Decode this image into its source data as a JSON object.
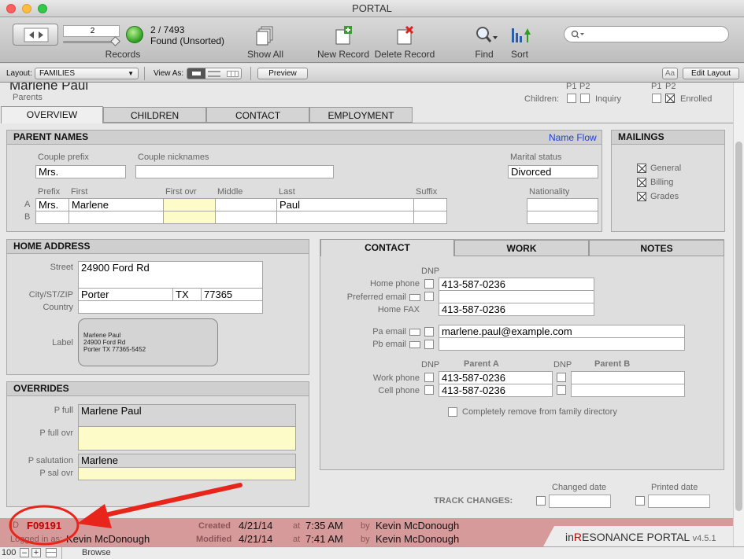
{
  "window": {
    "title": "PORTAL"
  },
  "toolbar": {
    "record_value": "2",
    "record_count": "2 / 7493",
    "found_status": "Found (Unsorted)",
    "records_label": "Records",
    "show_all": "Show All",
    "new_record": "New Record",
    "delete_record": "Delete Record",
    "find": "Find",
    "sort": "Sort",
    "search_value": ""
  },
  "layoutbar": {
    "layout_label": "Layout:",
    "layout_value": "FAMILIES",
    "view_as_label": "View As:",
    "preview": "Preview",
    "aa": "Aa",
    "edit_layout": "Edit Layout"
  },
  "header": {
    "name": "Marlene Paul",
    "subtitle": "Parents",
    "children_label": "Children:",
    "p1": "P1",
    "p2": "P2",
    "inquiry": "Inquiry",
    "enrolled": "Enrolled"
  },
  "tabs": [
    "OVERVIEW",
    "CHILDREN",
    "CONTACT",
    "EMPLOYMENT"
  ],
  "parent_names": {
    "title": "PARENT NAMES",
    "name_flow": "Name Flow",
    "couple_prefix_label": "Couple prefix",
    "couple_prefix": "Mrs.",
    "couple_nicknames_label": "Couple nicknames",
    "couple_nicknames": "",
    "marital_status_label": "Marital status",
    "marital_status": "Divorced",
    "prefix_label": "Prefix",
    "first_label": "First",
    "first_ovr_label": "First ovr",
    "middle_label": "Middle",
    "last_label": "Last",
    "suffix_label": "Suffix",
    "nationality_label": "Nationality",
    "row_a": "A",
    "row_b": "B",
    "a_prefix": "Mrs.",
    "a_first": "Marlene",
    "a_last": "Paul"
  },
  "mailings": {
    "title": "MAILINGS",
    "general": "General",
    "billing": "Billing",
    "grades": "Grades"
  },
  "home_address": {
    "title": "HOME ADDRESS",
    "street_label": "Street",
    "street": "24900 Ford Rd",
    "city_label": "City/ST/ZIP",
    "city": "Porter",
    "state": "TX",
    "zip": "77365",
    "country_label": "Country",
    "country": "",
    "label_label": "Label",
    "label_line1": "Marlene Paul",
    "label_line2": "24900 Ford Rd",
    "label_line3": "Porter TX 77365-5452"
  },
  "contact": {
    "tabs": [
      "CONTACT",
      "WORK",
      "NOTES"
    ],
    "dnp": "DNP",
    "home_phone_label": "Home phone",
    "home_phone": "413-587-0236",
    "preferred_email_label": "Preferred email",
    "home_fax_label": "Home FAX",
    "home_fax": "413-587-0236",
    "pa_email_label": "Pa email",
    "pa_email": "marlene.paul@example.com",
    "pb_email_label": "Pb email",
    "parent_a": "Parent A",
    "parent_b": "Parent B",
    "work_phone_label": "Work phone",
    "work_phone": "413-587-0236",
    "cell_phone_label": "Cell phone",
    "cell_phone": "413-587-0236",
    "remove_label": "Completely remove from family directory"
  },
  "overrides": {
    "title": "OVERRIDES",
    "p_full_label": "P full",
    "p_full": "Marlene Paul",
    "p_full_ovr_label": "P full ovr",
    "p_salutation_label": "P salutation",
    "p_salutation": "Marlene",
    "p_sal_ovr_label": "P sal ovr"
  },
  "track": {
    "title": "TRACK CHANGES:",
    "changed_date": "Changed date",
    "printed_date": "Printed date"
  },
  "footer": {
    "id_label": "ID",
    "id_value": "F09191",
    "logged_in_label": "Logged in as:",
    "logged_in_user": "Kevin McDonough",
    "created_label": "Created",
    "created_date": "4/21/14",
    "created_at": "at",
    "created_time": "7:35 AM",
    "created_by": "by",
    "created_user": "Kevin McDonough",
    "modified_label": "Modified",
    "modified_date": "4/21/14",
    "modified_at": "at",
    "modified_time": "7:41 AM",
    "modified_by": "by",
    "modified_user": "Kevin McDonough",
    "brand_in": "in",
    "brand_r": "R",
    "brand_rest": "ESONANCE PORTAL",
    "version": "v4.5.1"
  },
  "statusbar": {
    "zoom": "100",
    "mode": "Browse"
  },
  "colors": {
    "annotation": "#e8251a",
    "footer_bg": "#d79a9a",
    "yellow_field": "#fdfcc8",
    "brand_r": "#c40000"
  }
}
